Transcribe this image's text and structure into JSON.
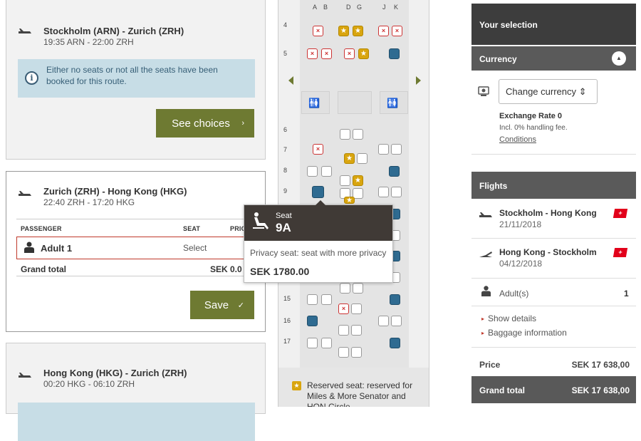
{
  "flights_left": [
    {
      "route": "Stockholm (ARN) - Zurich (ZRH)",
      "times": "19:35 ARN - 22:00 ZRH",
      "info": "Either no seats or not all the seats have been booked for this route.",
      "button": "See choices",
      "button_icon": "chevron-right"
    },
    {
      "route": "Zurich (ZRH) - Hong Kong (HKG)",
      "times": "22:40 ZRH - 17:20 HKG",
      "table": {
        "headers": {
          "passenger": "PASSENGER",
          "seat": "SEAT",
          "price": "PRIC"
        },
        "row": {
          "name": "Adult 1",
          "seat": "Select"
        },
        "total_label": "Grand total",
        "total_value": "SEK 0.0"
      },
      "button": "Save",
      "button_icon": "check"
    },
    {
      "route": "Hong Kong (HKG) - Zurich (ZRH)",
      "times": "00:20 HKG - 06:10 ZRH"
    }
  ],
  "seatmap": {
    "columns": [
      "A",
      "B",
      "D",
      "G",
      "J",
      "K"
    ],
    "rows": [
      "4",
      "5",
      "6",
      "7",
      "8",
      "9",
      "15",
      "16",
      "17"
    ],
    "seat_symbols": {
      "blocked": "×",
      "reserved": "★"
    }
  },
  "tooltip": {
    "label": "Seat",
    "seat": "9A",
    "description": "Privacy seat: seat with more privacy",
    "price": "SEK 1780.00",
    "icon": "seat-recline-icon"
  },
  "legend": {
    "text": "Reserved seat: reserved for Miles & More Senator and HON Circle",
    "icon": "star-icon"
  },
  "selection": {
    "title": "Your selection",
    "currency_title": "Currency",
    "currency_button": "Change currency ⇕",
    "exchange_rate": "Exchange Rate 0",
    "handling_fee": "Incl. 0% handling fee.",
    "conditions": "Conditions",
    "flights_title": "Flights",
    "flights": [
      {
        "route": "Stockholm - Hong Kong",
        "date": "21/11/2018",
        "icon": "takeoff-icon"
      },
      {
        "route": "Hong Kong - Stockholm",
        "date": "04/12/2018",
        "icon": "landing-icon"
      }
    ],
    "adults_label": "Adult(s)",
    "adults_count": "1",
    "show_details": "Show details",
    "baggage_info": "Baggage information",
    "price_label": "Price",
    "price_value": "SEK 17 638,00",
    "grand_total_label": "Grand total",
    "grand_total_value": "SEK 17 638,00"
  },
  "colors": {
    "accent_olive": "#6e7a32",
    "dark_panel": "#3d3d3d",
    "info_blue": "#c7dde6",
    "seat_blue": "#2f6b91",
    "seat_star": "#d9a50f",
    "swiss_red": "#e2001a"
  }
}
